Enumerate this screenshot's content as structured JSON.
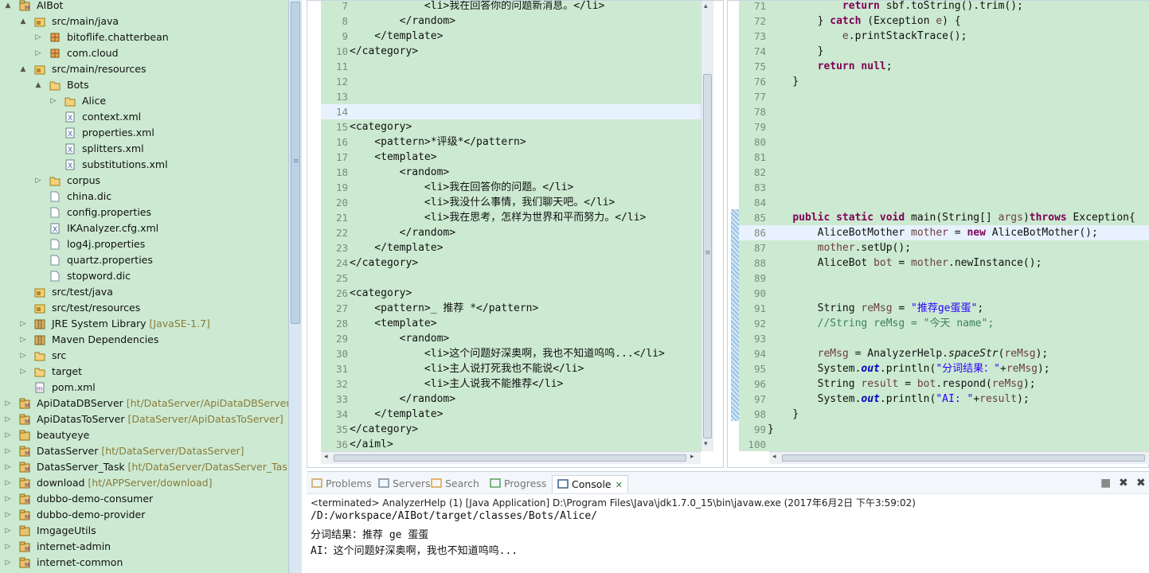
{
  "project_tree": {
    "rows": [
      {
        "indent": 0,
        "arrow": "▲",
        "icon": "maven-project-icon",
        "label": "AIBot",
        "decoration": ""
      },
      {
        "indent": 1,
        "arrow": "▲",
        "icon": "source-folder-icon",
        "label": "src/main/java",
        "decoration": ""
      },
      {
        "indent": 2,
        "arrow": "▷",
        "icon": "package-icon",
        "label": "bitoflife.chatterbean",
        "decoration": ""
      },
      {
        "indent": 2,
        "arrow": "▷",
        "icon": "package-icon",
        "label": "com.cloud",
        "decoration": ""
      },
      {
        "indent": 1,
        "arrow": "▲",
        "icon": "source-folder-icon",
        "label": "src/main/resources",
        "decoration": ""
      },
      {
        "indent": 2,
        "arrow": "▲",
        "icon": "folder-icon",
        "label": "Bots",
        "decoration": ""
      },
      {
        "indent": 3,
        "arrow": "▷",
        "icon": "folder-icon",
        "label": "Alice",
        "decoration": ""
      },
      {
        "indent": 3,
        "arrow": "",
        "icon": "xml-file-icon",
        "label": "context.xml",
        "decoration": ""
      },
      {
        "indent": 3,
        "arrow": "",
        "icon": "xml-file-icon",
        "label": "properties.xml",
        "decoration": ""
      },
      {
        "indent": 3,
        "arrow": "",
        "icon": "xml-file-icon",
        "label": "splitters.xml",
        "decoration": ""
      },
      {
        "indent": 3,
        "arrow": "",
        "icon": "xml-file-icon",
        "label": "substitutions.xml",
        "decoration": ""
      },
      {
        "indent": 2,
        "arrow": "▷",
        "icon": "folder-icon",
        "label": "corpus",
        "decoration": ""
      },
      {
        "indent": 2,
        "arrow": "",
        "icon": "file-icon",
        "label": "china.dic",
        "decoration": ""
      },
      {
        "indent": 2,
        "arrow": "",
        "icon": "file-icon",
        "label": "config.properties",
        "decoration": ""
      },
      {
        "indent": 2,
        "arrow": "",
        "icon": "xml-file-icon",
        "label": "IKAnalyzer.cfg.xml",
        "decoration": ""
      },
      {
        "indent": 2,
        "arrow": "",
        "icon": "file-icon",
        "label": "log4j.properties",
        "decoration": ""
      },
      {
        "indent": 2,
        "arrow": "",
        "icon": "file-icon",
        "label": "quartz.properties",
        "decoration": ""
      },
      {
        "indent": 2,
        "arrow": "",
        "icon": "file-icon",
        "label": "stopword.dic",
        "decoration": ""
      },
      {
        "indent": 1,
        "arrow": "",
        "icon": "source-folder-icon",
        "label": "src/test/java",
        "decoration": ""
      },
      {
        "indent": 1,
        "arrow": "",
        "icon": "source-folder-icon",
        "label": "src/test/resources",
        "decoration": ""
      },
      {
        "indent": 1,
        "arrow": "▷",
        "icon": "library-icon",
        "label": "JRE System Library",
        "decoration": "[JavaSE-1.7]"
      },
      {
        "indent": 1,
        "arrow": "▷",
        "icon": "library-icon",
        "label": "Maven Dependencies",
        "decoration": ""
      },
      {
        "indent": 1,
        "arrow": "▷",
        "icon": "folder-icon",
        "label": "src",
        "decoration": ""
      },
      {
        "indent": 1,
        "arrow": "▷",
        "icon": "folder-icon",
        "label": "target",
        "decoration": ""
      },
      {
        "indent": 1,
        "arrow": "",
        "icon": "maven-file-icon",
        "label": "pom.xml",
        "decoration": ""
      },
      {
        "indent": 0,
        "arrow": "▷",
        "icon": "maven-project-icon",
        "label": "ApiDataDBServer",
        "decoration": "[ht/DataServer/ApiDataDBServer]"
      },
      {
        "indent": 0,
        "arrow": "▷",
        "icon": "maven-project-icon",
        "label": "ApiDatasToServer",
        "decoration": "[DataServer/ApiDatasToServer]"
      },
      {
        "indent": 0,
        "arrow": "▷",
        "icon": "project-icon",
        "label": "beautyeye",
        "decoration": ""
      },
      {
        "indent": 0,
        "arrow": "▷",
        "icon": "maven-project-icon",
        "label": "DatasServer",
        "decoration": "[ht/DataServer/DatasServer]"
      },
      {
        "indent": 0,
        "arrow": "▷",
        "icon": "maven-project-icon",
        "label": "DatasServer_Task",
        "decoration": "[ht/DataServer/DatasServer_Task]"
      },
      {
        "indent": 0,
        "arrow": "▷",
        "icon": "maven-project-icon",
        "label": "download",
        "decoration": "[ht/APPServer/download]"
      },
      {
        "indent": 0,
        "arrow": "▷",
        "icon": "maven-project-icon",
        "label": "dubbo-demo-consumer",
        "decoration": ""
      },
      {
        "indent": 0,
        "arrow": "▷",
        "icon": "maven-project-icon",
        "label": "dubbo-demo-provider",
        "decoration": ""
      },
      {
        "indent": 0,
        "arrow": "▷",
        "icon": "project-icon",
        "label": "ImgageUtils",
        "decoration": ""
      },
      {
        "indent": 0,
        "arrow": "▷",
        "icon": "maven-project-icon",
        "label": "internet-admin",
        "decoration": ""
      },
      {
        "indent": 0,
        "arrow": "▷",
        "icon": "maven-project-icon",
        "label": "internet-common",
        "decoration": ""
      }
    ]
  },
  "editor_xml": {
    "lines": [
      {
        "n": "7",
        "parts": [
          [
            "",
            "            <li>我在回答你的问题新消息。</li>"
          ]
        ]
      },
      {
        "n": "8",
        "parts": [
          [
            "",
            "        </random>"
          ]
        ]
      },
      {
        "n": "9",
        "parts": [
          [
            "",
            "    </template>"
          ]
        ]
      },
      {
        "n": "10",
        "parts": [
          [
            "",
            "</category>"
          ]
        ]
      },
      {
        "n": "11",
        "parts": [
          [
            "",
            ""
          ]
        ]
      },
      {
        "n": "12",
        "parts": [
          [
            "",
            ""
          ]
        ]
      },
      {
        "n": "13",
        "parts": [
          [
            "",
            ""
          ]
        ]
      },
      {
        "n": "14",
        "parts": [
          [
            "",
            ""
          ]
        ],
        "current": true
      },
      {
        "n": "15",
        "parts": [
          [
            "",
            "<category>"
          ]
        ]
      },
      {
        "n": "16",
        "parts": [
          [
            "",
            "    <pattern>*评级*</pattern>"
          ]
        ]
      },
      {
        "n": "17",
        "parts": [
          [
            "",
            "    <template>"
          ]
        ]
      },
      {
        "n": "18",
        "parts": [
          [
            "",
            "        <random>"
          ]
        ]
      },
      {
        "n": "19",
        "parts": [
          [
            "",
            "            <li>我在回答你的问题。</li>"
          ]
        ]
      },
      {
        "n": "20",
        "parts": [
          [
            "",
            "            <li>我没什么事情，我们聊天吧。</li>"
          ]
        ]
      },
      {
        "n": "21",
        "parts": [
          [
            "",
            "            <li>我在思考，怎样为世界和平而努力。</li>"
          ]
        ]
      },
      {
        "n": "22",
        "parts": [
          [
            "",
            "        </random>"
          ]
        ]
      },
      {
        "n": "23",
        "parts": [
          [
            "",
            "    </template>"
          ]
        ]
      },
      {
        "n": "24",
        "parts": [
          [
            "",
            "</category>"
          ]
        ]
      },
      {
        "n": "25",
        "parts": [
          [
            "",
            ""
          ]
        ]
      },
      {
        "n": "26",
        "parts": [
          [
            "",
            "<category>"
          ]
        ]
      },
      {
        "n": "27",
        "parts": [
          [
            "",
            "    <pattern>_ 推荐 *</pattern>"
          ]
        ]
      },
      {
        "n": "28",
        "parts": [
          [
            "",
            "    <template>"
          ]
        ]
      },
      {
        "n": "29",
        "parts": [
          [
            "",
            "        <random>"
          ]
        ]
      },
      {
        "n": "30",
        "parts": [
          [
            "",
            "            <li>这个问题好深奥啊，我也不知道呜呜...</li>"
          ]
        ]
      },
      {
        "n": "31",
        "parts": [
          [
            "",
            "            <li>主人说打死我也不能说</li>"
          ]
        ]
      },
      {
        "n": "32",
        "parts": [
          [
            "",
            "            <li>主人说我不能推荐</li>"
          ]
        ]
      },
      {
        "n": "33",
        "parts": [
          [
            "",
            "        </random>"
          ]
        ]
      },
      {
        "n": "34",
        "parts": [
          [
            "",
            "    </template>"
          ]
        ]
      },
      {
        "n": "35",
        "parts": [
          [
            "",
            "</category>"
          ]
        ]
      },
      {
        "n": "36",
        "parts": [
          [
            "",
            "</aiml>"
          ]
        ]
      }
    ]
  },
  "editor_java": {
    "lines": [
      {
        "n": "71",
        "parts": [
          [
            "",
            "            "
          ],
          [
            "kw",
            "return"
          ],
          [
            "",
            " sbf.toString().trim();"
          ]
        ]
      },
      {
        "n": "72",
        "parts": [
          [
            "",
            "        } "
          ],
          [
            "kw",
            "catch"
          ],
          [
            "",
            " (Exception "
          ],
          [
            "var",
            "e"
          ],
          [
            "",
            ") {"
          ]
        ]
      },
      {
        "n": "73",
        "parts": [
          [
            "",
            "            "
          ],
          [
            "var",
            "e"
          ],
          [
            "",
            ".printStackTrace();"
          ]
        ]
      },
      {
        "n": "74",
        "parts": [
          [
            "",
            "        }"
          ]
        ]
      },
      {
        "n": "75",
        "parts": [
          [
            "",
            "        "
          ],
          [
            "kw",
            "return"
          ],
          [
            "",
            " "
          ],
          [
            "kw",
            "null"
          ],
          [
            "",
            ";"
          ]
        ]
      },
      {
        "n": "76",
        "parts": [
          [
            "",
            "    }"
          ]
        ]
      },
      {
        "n": "77",
        "parts": [
          [
            "",
            ""
          ]
        ]
      },
      {
        "n": "78",
        "parts": [
          [
            "",
            ""
          ]
        ]
      },
      {
        "n": "79",
        "parts": [
          [
            "",
            ""
          ]
        ]
      },
      {
        "n": "80",
        "parts": [
          [
            "",
            ""
          ]
        ]
      },
      {
        "n": "81",
        "parts": [
          [
            "",
            ""
          ]
        ]
      },
      {
        "n": "82",
        "parts": [
          [
            "",
            ""
          ]
        ]
      },
      {
        "n": "83",
        "parts": [
          [
            "",
            ""
          ]
        ]
      },
      {
        "n": "84",
        "parts": [
          [
            "",
            ""
          ]
        ]
      },
      {
        "n": "85",
        "parts": [
          [
            "",
            "    "
          ],
          [
            "kw",
            "public"
          ],
          [
            "",
            " "
          ],
          [
            "kw",
            "static"
          ],
          [
            "",
            " "
          ],
          [
            "kw",
            "void"
          ],
          [
            "",
            " main(String[] "
          ],
          [
            "var",
            "args"
          ],
          [
            "",
            ")"
          ],
          [
            "kw",
            "throws"
          ],
          [
            "",
            " Exception{"
          ]
        ]
      },
      {
        "n": "86",
        "parts": [
          [
            "",
            "        AliceBotMother "
          ],
          [
            "var",
            "mother"
          ],
          [
            "",
            " = "
          ],
          [
            "kw",
            "new"
          ],
          [
            "",
            " AliceBotMother();"
          ]
        ],
        "current": true
      },
      {
        "n": "87",
        "parts": [
          [
            "",
            "        "
          ],
          [
            "var",
            "mother"
          ],
          [
            "",
            ".setUp();"
          ]
        ]
      },
      {
        "n": "88",
        "parts": [
          [
            "",
            "        AliceBot "
          ],
          [
            "var",
            "bot"
          ],
          [
            "",
            " = "
          ],
          [
            "var",
            "mother"
          ],
          [
            "",
            ".newInstance();"
          ]
        ]
      },
      {
        "n": "89",
        "parts": [
          [
            "",
            ""
          ]
        ]
      },
      {
        "n": "90",
        "parts": [
          [
            "",
            ""
          ]
        ]
      },
      {
        "n": "91",
        "parts": [
          [
            "",
            "        String "
          ],
          [
            "var",
            "reMsg"
          ],
          [
            "",
            " = "
          ],
          [
            "str",
            "\"推荐ge蛋蛋\""
          ],
          [
            "",
            ";"
          ]
        ]
      },
      {
        "n": "92",
        "parts": [
          [
            "",
            "        "
          ],
          [
            "cmt",
            "//String reMsg = \"今天 name\";"
          ]
        ]
      },
      {
        "n": "93",
        "parts": [
          [
            "",
            ""
          ]
        ]
      },
      {
        "n": "94",
        "parts": [
          [
            "",
            "        "
          ],
          [
            "var",
            "reMsg"
          ],
          [
            "",
            " = AnalyzerHelp."
          ],
          [
            "sm",
            "spaceStr"
          ],
          [
            "",
            "("
          ],
          [
            "var",
            "reMsg"
          ],
          [
            "",
            ");"
          ]
        ]
      },
      {
        "n": "95",
        "parts": [
          [
            "",
            "        System."
          ],
          [
            "fld",
            "out"
          ],
          [
            "",
            ".println("
          ],
          [
            "str",
            "\"分词结果：\""
          ],
          [
            "",
            "+"
          ],
          [
            "var",
            "reMsg"
          ],
          [
            "",
            ");"
          ]
        ]
      },
      {
        "n": "96",
        "parts": [
          [
            "",
            "        String "
          ],
          [
            "var",
            "result"
          ],
          [
            "",
            " = "
          ],
          [
            "var",
            "bot"
          ],
          [
            "",
            ".respond("
          ],
          [
            "var",
            "reMsg"
          ],
          [
            "",
            ");"
          ]
        ]
      },
      {
        "n": "97",
        "parts": [
          [
            "",
            "        System."
          ],
          [
            "fld",
            "out"
          ],
          [
            "",
            ".println("
          ],
          [
            "str",
            "\"AI: \""
          ],
          [
            "",
            "+"
          ],
          [
            "var",
            "result"
          ],
          [
            "",
            ");"
          ]
        ]
      },
      {
        "n": "98",
        "parts": [
          [
            "",
            "    }"
          ]
        ]
      },
      {
        "n": "99",
        "parts": [
          [
            "",
            "}"
          ]
        ]
      },
      {
        "n": "100",
        "parts": [
          [
            "",
            ""
          ]
        ]
      }
    ]
  },
  "console": {
    "tabs": [
      {
        "label": "Problems",
        "icon": "problems-icon",
        "active": false
      },
      {
        "label": "Servers",
        "icon": "servers-icon",
        "active": false
      },
      {
        "label": "Search",
        "icon": "search-icon",
        "active": false
      },
      {
        "label": "Progress",
        "icon": "progress-icon",
        "active": false
      },
      {
        "label": "Console",
        "icon": "console-icon",
        "active": true
      }
    ],
    "close_glyph": "✕",
    "status": "<terminated> AnalyzerHelp (1) [Java Application] D:\\Program Files\\Java\\jdk1.7.0_15\\bin\\javaw.exe (2017年6月2日 下午3:59:02)",
    "output": [
      "/D:/workspace/AIBot/target/classes/Bots/Alice/",
      "分词结果：推荐 ge 蛋蛋",
      "AI：这个问题好深奥啊，我也不知道呜呜..."
    ],
    "buttons": [
      {
        "name": "terminate-icon",
        "glyph": "■"
      },
      {
        "name": "remove-launch-icon",
        "glyph": "✖"
      },
      {
        "name": "remove-all-icon",
        "glyph": "✖"
      }
    ]
  },
  "colors": {
    "editor_bg": "#ccead1",
    "keyword": "#7f0055",
    "string": "#2a00ff",
    "comment": "#3f7f5f",
    "current_line": "#e8f2fe"
  }
}
